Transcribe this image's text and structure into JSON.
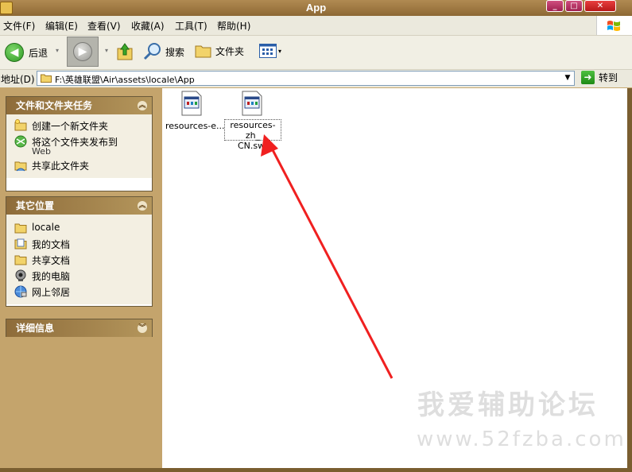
{
  "window": {
    "title": "App"
  },
  "menu": [
    "文件(F)",
    "编辑(E)",
    "查看(V)",
    "收藏(A)",
    "工具(T)",
    "帮助(H)"
  ],
  "toolbar": {
    "back": "后退",
    "search": "搜索",
    "folders": "文件夹"
  },
  "address": {
    "label": "地址(D)",
    "path": "F:\\英雄联盟\\Air\\assets\\locale\\App",
    "go": "转到"
  },
  "tasks_panel": {
    "title": "文件和文件夹任务",
    "items": [
      "创建一个新文件夹",
      "将这个文件夹发布到",
      "共享此文件夹"
    ],
    "publish_sub": "Web"
  },
  "places_panel": {
    "title": "其它位置",
    "items": [
      "locale",
      "我的文档",
      "共享文档",
      "我的电脑",
      "网上邻居"
    ]
  },
  "details_panel": {
    "title": "详细信息"
  },
  "files": [
    {
      "name": "resources-e...",
      "selected": false
    },
    {
      "name_line1": "resources-zh_",
      "name_line2": "CN.swf",
      "selected": true
    }
  ],
  "watermark": {
    "cn": "我爱辅助论坛",
    "url": "www.52fzba.com"
  }
}
